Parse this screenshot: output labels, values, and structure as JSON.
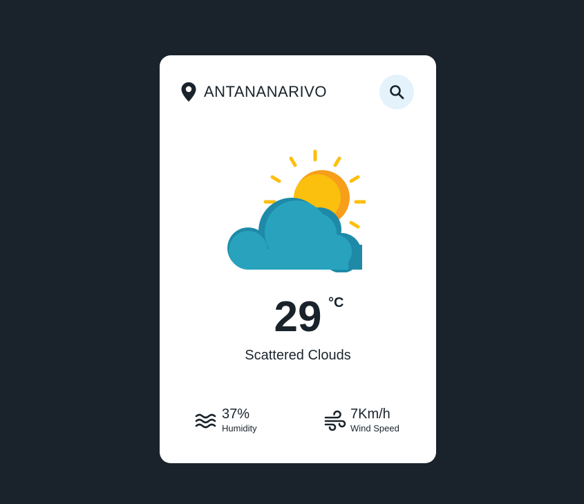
{
  "location": {
    "city": "ANTANANARIVO",
    "icon": "map-pin-icon"
  },
  "search": {
    "icon": "search-icon"
  },
  "weather": {
    "icon": "sun-behind-cloud-icon",
    "temperature": "29",
    "unit": "°C",
    "description": "Scattered Clouds"
  },
  "stats": {
    "humidity": {
      "icon": "waves-icon",
      "value": "37%",
      "label": "Humidity"
    },
    "wind": {
      "icon": "wind-icon",
      "value": "7Km/h",
      "label": "Wind Speed"
    }
  },
  "colors": {
    "background": "#1a232b",
    "card": "#ffffff",
    "text": "#1a232b",
    "search_bg": "#e3f2fb",
    "sun": "#fbbf0e",
    "sun_shade": "#f79e1b",
    "cloud": "#29a3bd",
    "cloud_shade": "#1e8aa8"
  }
}
